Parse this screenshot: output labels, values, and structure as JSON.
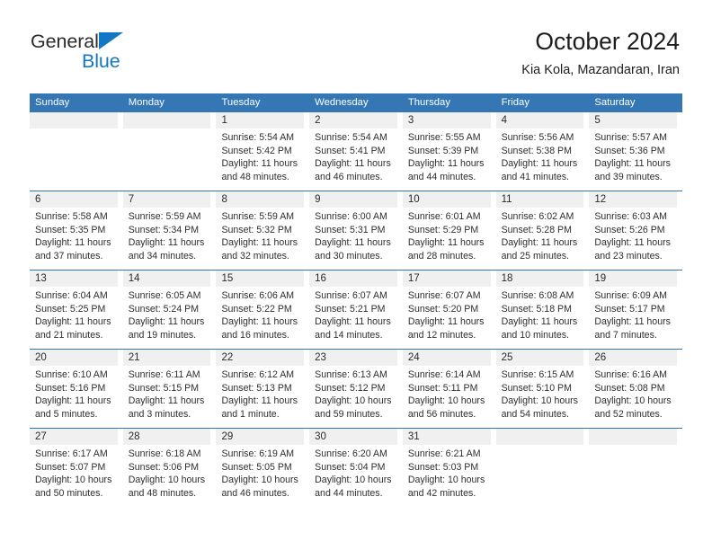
{
  "brand": {
    "name_part1": "General",
    "name_part2": "Blue",
    "logo_icon": "triangle-icon",
    "colors": {
      "accent": "#1277c4",
      "header": "#3576b4",
      "band": "#f0f0f0"
    }
  },
  "header": {
    "title": "October 2024",
    "subtitle": "Kia Kola, Mazandaran, Iran"
  },
  "calendar": {
    "weekday_headers": [
      "Sunday",
      "Monday",
      "Tuesday",
      "Wednesday",
      "Thursday",
      "Friday",
      "Saturday"
    ],
    "labels": {
      "sunrise": "Sunrise:",
      "sunset": "Sunset:",
      "daylight": "Daylight:"
    },
    "weeks": [
      [
        {
          "day": "",
          "sunrise": "",
          "sunset": "",
          "daylight": ""
        },
        {
          "day": "",
          "sunrise": "",
          "sunset": "",
          "daylight": ""
        },
        {
          "day": "1",
          "sunrise": "Sunrise: 5:54 AM",
          "sunset": "Sunset: 5:42 PM",
          "daylight": "Daylight: 11 hours and 48 minutes."
        },
        {
          "day": "2",
          "sunrise": "Sunrise: 5:54 AM",
          "sunset": "Sunset: 5:41 PM",
          "daylight": "Daylight: 11 hours and 46 minutes."
        },
        {
          "day": "3",
          "sunrise": "Sunrise: 5:55 AM",
          "sunset": "Sunset: 5:39 PM",
          "daylight": "Daylight: 11 hours and 44 minutes."
        },
        {
          "day": "4",
          "sunrise": "Sunrise: 5:56 AM",
          "sunset": "Sunset: 5:38 PM",
          "daylight": "Daylight: 11 hours and 41 minutes."
        },
        {
          "day": "5",
          "sunrise": "Sunrise: 5:57 AM",
          "sunset": "Sunset: 5:36 PM",
          "daylight": "Daylight: 11 hours and 39 minutes."
        }
      ],
      [
        {
          "day": "6",
          "sunrise": "Sunrise: 5:58 AM",
          "sunset": "Sunset: 5:35 PM",
          "daylight": "Daylight: 11 hours and 37 minutes."
        },
        {
          "day": "7",
          "sunrise": "Sunrise: 5:59 AM",
          "sunset": "Sunset: 5:34 PM",
          "daylight": "Daylight: 11 hours and 34 minutes."
        },
        {
          "day": "8",
          "sunrise": "Sunrise: 5:59 AM",
          "sunset": "Sunset: 5:32 PM",
          "daylight": "Daylight: 11 hours and 32 minutes."
        },
        {
          "day": "9",
          "sunrise": "Sunrise: 6:00 AM",
          "sunset": "Sunset: 5:31 PM",
          "daylight": "Daylight: 11 hours and 30 minutes."
        },
        {
          "day": "10",
          "sunrise": "Sunrise: 6:01 AM",
          "sunset": "Sunset: 5:29 PM",
          "daylight": "Daylight: 11 hours and 28 minutes."
        },
        {
          "day": "11",
          "sunrise": "Sunrise: 6:02 AM",
          "sunset": "Sunset: 5:28 PM",
          "daylight": "Daylight: 11 hours and 25 minutes."
        },
        {
          "day": "12",
          "sunrise": "Sunrise: 6:03 AM",
          "sunset": "Sunset: 5:26 PM",
          "daylight": "Daylight: 11 hours and 23 minutes."
        }
      ],
      [
        {
          "day": "13",
          "sunrise": "Sunrise: 6:04 AM",
          "sunset": "Sunset: 5:25 PM",
          "daylight": "Daylight: 11 hours and 21 minutes."
        },
        {
          "day": "14",
          "sunrise": "Sunrise: 6:05 AM",
          "sunset": "Sunset: 5:24 PM",
          "daylight": "Daylight: 11 hours and 19 minutes."
        },
        {
          "day": "15",
          "sunrise": "Sunrise: 6:06 AM",
          "sunset": "Sunset: 5:22 PM",
          "daylight": "Daylight: 11 hours and 16 minutes."
        },
        {
          "day": "16",
          "sunrise": "Sunrise: 6:07 AM",
          "sunset": "Sunset: 5:21 PM",
          "daylight": "Daylight: 11 hours and 14 minutes."
        },
        {
          "day": "17",
          "sunrise": "Sunrise: 6:07 AM",
          "sunset": "Sunset: 5:20 PM",
          "daylight": "Daylight: 11 hours and 12 minutes."
        },
        {
          "day": "18",
          "sunrise": "Sunrise: 6:08 AM",
          "sunset": "Sunset: 5:18 PM",
          "daylight": "Daylight: 11 hours and 10 minutes."
        },
        {
          "day": "19",
          "sunrise": "Sunrise: 6:09 AM",
          "sunset": "Sunset: 5:17 PM",
          "daylight": "Daylight: 11 hours and 7 minutes."
        }
      ],
      [
        {
          "day": "20",
          "sunrise": "Sunrise: 6:10 AM",
          "sunset": "Sunset: 5:16 PM",
          "daylight": "Daylight: 11 hours and 5 minutes."
        },
        {
          "day": "21",
          "sunrise": "Sunrise: 6:11 AM",
          "sunset": "Sunset: 5:15 PM",
          "daylight": "Daylight: 11 hours and 3 minutes."
        },
        {
          "day": "22",
          "sunrise": "Sunrise: 6:12 AM",
          "sunset": "Sunset: 5:13 PM",
          "daylight": "Daylight: 11 hours and 1 minute."
        },
        {
          "day": "23",
          "sunrise": "Sunrise: 6:13 AM",
          "sunset": "Sunset: 5:12 PM",
          "daylight": "Daylight: 10 hours and 59 minutes."
        },
        {
          "day": "24",
          "sunrise": "Sunrise: 6:14 AM",
          "sunset": "Sunset: 5:11 PM",
          "daylight": "Daylight: 10 hours and 56 minutes."
        },
        {
          "day": "25",
          "sunrise": "Sunrise: 6:15 AM",
          "sunset": "Sunset: 5:10 PM",
          "daylight": "Daylight: 10 hours and 54 minutes."
        },
        {
          "day": "26",
          "sunrise": "Sunrise: 6:16 AM",
          "sunset": "Sunset: 5:08 PM",
          "daylight": "Daylight: 10 hours and 52 minutes."
        }
      ],
      [
        {
          "day": "27",
          "sunrise": "Sunrise: 6:17 AM",
          "sunset": "Sunset: 5:07 PM",
          "daylight": "Daylight: 10 hours and 50 minutes."
        },
        {
          "day": "28",
          "sunrise": "Sunrise: 6:18 AM",
          "sunset": "Sunset: 5:06 PM",
          "daylight": "Daylight: 10 hours and 48 minutes."
        },
        {
          "day": "29",
          "sunrise": "Sunrise: 6:19 AM",
          "sunset": "Sunset: 5:05 PM",
          "daylight": "Daylight: 10 hours and 46 minutes."
        },
        {
          "day": "30",
          "sunrise": "Sunrise: 6:20 AM",
          "sunset": "Sunset: 5:04 PM",
          "daylight": "Daylight: 10 hours and 44 minutes."
        },
        {
          "day": "31",
          "sunrise": "Sunrise: 6:21 AM",
          "sunset": "Sunset: 5:03 PM",
          "daylight": "Daylight: 10 hours and 42 minutes."
        },
        {
          "day": "",
          "sunrise": "",
          "sunset": "",
          "daylight": ""
        },
        {
          "day": "",
          "sunrise": "",
          "sunset": "",
          "daylight": ""
        }
      ]
    ]
  }
}
